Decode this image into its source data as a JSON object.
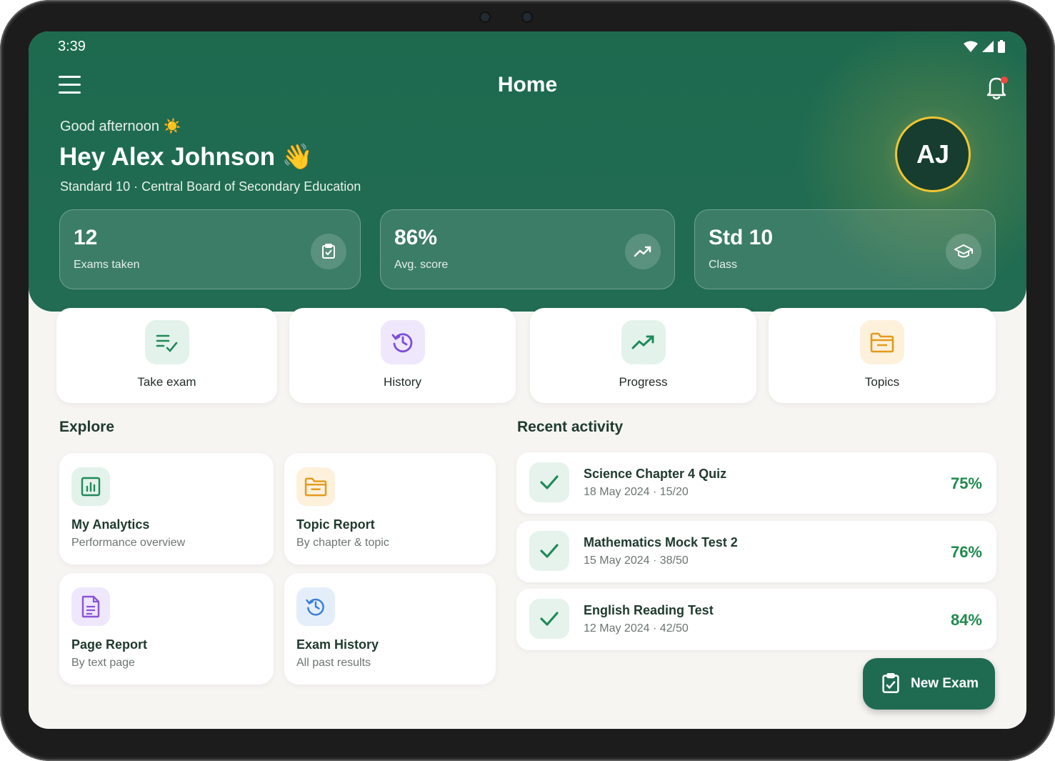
{
  "status_bar": {
    "time": "3:39"
  },
  "header": {
    "title": "Home",
    "greeting": "Good afternoon ☀️",
    "hello": "Hey Alex Johnson 👋",
    "subline": "Standard 10 · Central Board of Secondary Education",
    "avatar_initials": "AJ"
  },
  "stats": [
    {
      "value": "12",
      "label": "Exams taken",
      "icon": "clipboard-check-icon"
    },
    {
      "value": "86%",
      "label": "Avg. score",
      "icon": "trending-up-icon"
    },
    {
      "value": "Std 10",
      "label": "Class",
      "icon": "graduation-cap-icon"
    }
  ],
  "quick_actions": [
    {
      "label": "Take exam",
      "icon": "edit-list-icon",
      "color": "#1f8a5a",
      "bg": "#e3f2ea"
    },
    {
      "label": "History",
      "icon": "history-icon",
      "color": "#7c4fd8",
      "bg": "#efe7fb"
    },
    {
      "label": "Progress",
      "icon": "trending-up-icon",
      "color": "#1f8a5a",
      "bg": "#e3f2ea"
    },
    {
      "label": "Topics",
      "icon": "folder-icon",
      "color": "#e39a1c",
      "bg": "#fdf1dc"
    }
  ],
  "explore": {
    "title": "Explore",
    "cards": [
      {
        "title": "My Analytics",
        "subtitle": "Performance overview",
        "icon": "bar-chart-icon",
        "color": "#1f8a5a",
        "bg": "#e3f2ea"
      },
      {
        "title": "Topic Report",
        "subtitle": "By chapter & topic",
        "icon": "folder-icon",
        "color": "#e39a1c",
        "bg": "#fdf1dc"
      },
      {
        "title": "Page Report",
        "subtitle": "By text page",
        "icon": "document-icon",
        "color": "#8a55d8",
        "bg": "#efe7fb"
      },
      {
        "title": "Exam History",
        "subtitle": "All past results",
        "icon": "history-icon",
        "color": "#3a7fd8",
        "bg": "#e4eefb"
      }
    ]
  },
  "recent": {
    "title": "Recent activity",
    "items": [
      {
        "title": "Science Chapter 4 Quiz",
        "detail": "18 May 2024 · 15/20",
        "score": "75%"
      },
      {
        "title": "Mathematics Mock Test 2",
        "detail": "15 May 2024 · 38/50",
        "score": "76%"
      },
      {
        "title": "English Reading Test",
        "detail": "12 May 2024 · 42/50",
        "score": "84%"
      }
    ]
  },
  "fab": {
    "label": "New Exam",
    "icon": "clipboard-check-icon"
  },
  "colors": {
    "primary": "#1f6b51",
    "accent_gold": "#f0c531",
    "score_green": "#1f8a4e",
    "notification_dot": "#f0473d"
  }
}
